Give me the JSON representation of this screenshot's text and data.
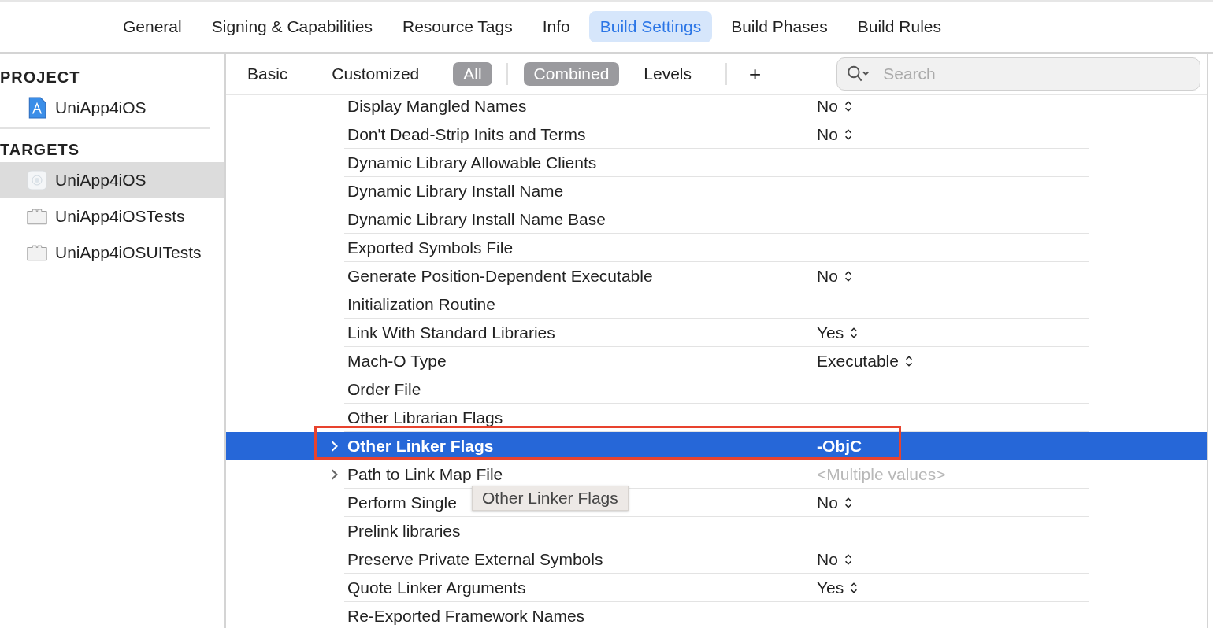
{
  "tabs": [
    {
      "label": "General",
      "selected": false
    },
    {
      "label": "Signing & Capabilities",
      "selected": false
    },
    {
      "label": "Resource Tags",
      "selected": false
    },
    {
      "label": "Info",
      "selected": false
    },
    {
      "label": "Build Settings",
      "selected": true
    },
    {
      "label": "Build Phases",
      "selected": false
    },
    {
      "label": "Build Rules",
      "selected": false
    }
  ],
  "sidebar": {
    "sections": [
      {
        "title": "PROJECT",
        "items": [
          {
            "label": "UniApp4iOS",
            "kind": "project",
            "selected": false
          }
        ]
      },
      {
        "title": "TARGETS",
        "items": [
          {
            "label": "UniApp4iOS",
            "kind": "app",
            "selected": true
          },
          {
            "label": "UniApp4iOSTests",
            "kind": "bundle",
            "selected": false
          },
          {
            "label": "UniApp4iOSUITests",
            "kind": "bundle",
            "selected": false
          }
        ]
      }
    ]
  },
  "filter_bar": {
    "scope": [
      {
        "label": "Basic",
        "selected": false
      },
      {
        "label": "Customized",
        "selected": false
      },
      {
        "label": "All",
        "selected": true
      }
    ],
    "view": [
      {
        "label": "Combined",
        "selected": true
      },
      {
        "label": "Levels",
        "selected": false
      }
    ],
    "add": "+",
    "search": {
      "placeholder": "Search"
    }
  },
  "settings": [
    {
      "name": "Display Mangled Names",
      "value": "No",
      "kind": "popup",
      "expandable": false,
      "selected": false,
      "outlined": false
    },
    {
      "name": "Don't Dead-Strip Inits and Terms",
      "value": "No",
      "kind": "popup",
      "expandable": false,
      "selected": false,
      "outlined": false
    },
    {
      "name": "Dynamic Library Allowable Clients",
      "kind": "empty",
      "expandable": false,
      "selected": false,
      "outlined": false
    },
    {
      "name": "Dynamic Library Install Name",
      "kind": "empty",
      "expandable": false,
      "selected": false,
      "outlined": false
    },
    {
      "name": "Dynamic Library Install Name Base",
      "kind": "empty",
      "expandable": false,
      "selected": false,
      "outlined": false
    },
    {
      "name": "Exported Symbols File",
      "kind": "empty",
      "expandable": false,
      "selected": false,
      "outlined": false
    },
    {
      "name": "Generate Position-Dependent Executable",
      "value": "No",
      "kind": "popup",
      "expandable": false,
      "selected": false,
      "outlined": false
    },
    {
      "name": "Initialization Routine",
      "kind": "empty",
      "expandable": false,
      "selected": false,
      "outlined": false
    },
    {
      "name": "Link With Standard Libraries",
      "value": "Yes",
      "kind": "popup",
      "expandable": false,
      "selected": false,
      "outlined": false
    },
    {
      "name": "Mach-O Type",
      "value": "Executable",
      "kind": "popup",
      "expandable": false,
      "selected": false,
      "outlined": false
    },
    {
      "name": "Order File",
      "kind": "empty",
      "expandable": false,
      "selected": false,
      "outlined": false
    },
    {
      "name": "Other Librarian Flags",
      "kind": "empty",
      "expandable": false,
      "selected": false,
      "outlined": false
    },
    {
      "name": "Other Linker Flags",
      "value": "-ObjC",
      "kind": "text",
      "expandable": true,
      "selected": true,
      "outlined": true
    },
    {
      "name": "Path to Link Map File",
      "value": "<Multiple values>",
      "kind": "multiple",
      "expandable": true,
      "selected": false,
      "outlined": false
    },
    {
      "name": "Perform Single",
      "value": "No",
      "kind": "popup",
      "expandable": false,
      "selected": false,
      "outlined": false
    },
    {
      "name": "Prelink libraries",
      "kind": "empty",
      "expandable": false,
      "selected": false,
      "outlined": false
    },
    {
      "name": "Preserve Private External Symbols",
      "value": "No",
      "kind": "popup",
      "expandable": false,
      "selected": false,
      "outlined": false
    },
    {
      "name": "Quote Linker Arguments",
      "value": "Yes",
      "kind": "popup",
      "expandable": false,
      "selected": false,
      "outlined": false
    },
    {
      "name": "Re-Exported Framework Names",
      "kind": "empty",
      "expandable": false,
      "selected": false,
      "outlined": false
    }
  ],
  "tooltip": "Other Linker Flags"
}
